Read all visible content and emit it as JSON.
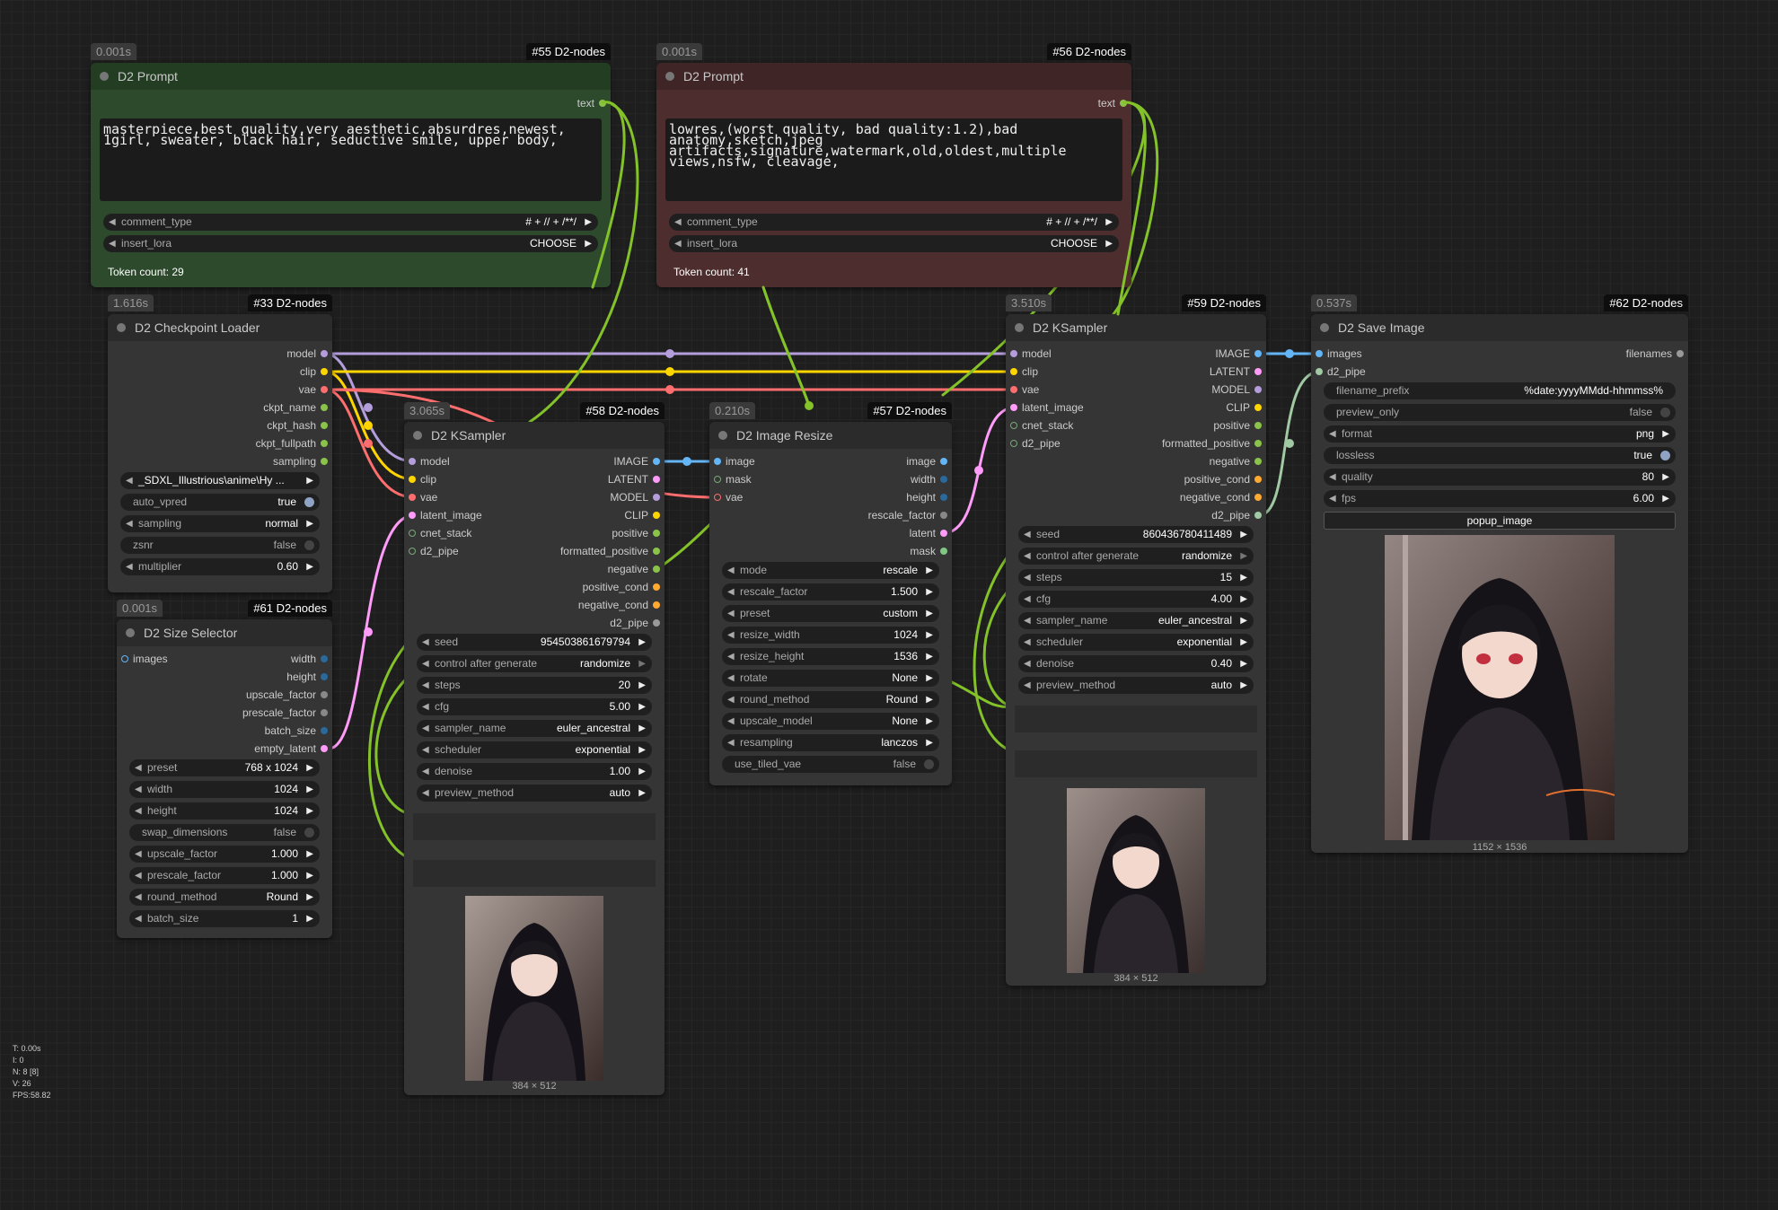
{
  "nodes": {
    "n55": {
      "time": "0.001s",
      "id": "#55 D2-nodes",
      "title": "D2 Prompt",
      "output": "text",
      "text": "masterpiece,best quality,very aesthetic,absurdres,newest,\n1girl, sweater, black hair, seductive smile, upper body,",
      "comment_type_label": "comment_type",
      "comment_type_value": "# + // + /**/",
      "insert_lora_label": "insert_lora",
      "insert_lora_value": "CHOOSE",
      "token": "Token count: 29"
    },
    "n56": {
      "time": "0.001s",
      "id": "#56 D2-nodes",
      "title": "D2 Prompt",
      "output": "text",
      "text": "lowres,(worst quality, bad quality:1.2),bad\nanatomy,sketch,jpeg\nartifacts,signature,watermark,old,oldest,multiple\nviews,nsfw, cleavage,",
      "comment_type_label": "comment_type",
      "comment_type_value": "# + // + /**/",
      "insert_lora_label": "insert_lora",
      "insert_lora_value": "CHOOSE",
      "token": "Token count: 41"
    },
    "n33": {
      "time": "1.616s",
      "id": "#33 D2-nodes",
      "title": "D2 Checkpoint Loader",
      "outputs": [
        "model",
        "clip",
        "vae",
        "ckpt_name",
        "ckpt_hash",
        "ckpt_fullpath",
        "sampling"
      ],
      "widgets": [
        [
          "_SDXL_Illustrious\\anime\\Hy ...",
          ""
        ],
        [
          "auto_vpred",
          "true"
        ],
        [
          "sampling",
          "normal"
        ],
        [
          "zsnr",
          "false"
        ],
        [
          "multiplier",
          "0.60"
        ]
      ]
    },
    "n61": {
      "time": "0.001s",
      "id": "#61 D2-nodes",
      "title": "D2 Size Selector",
      "input": "images",
      "outputs": [
        "width",
        "height",
        "upscale_factor",
        "prescale_factor",
        "batch_size",
        "empty_latent"
      ],
      "widgets": [
        [
          "preset",
          "768 x 1024"
        ],
        [
          "width",
          "1024"
        ],
        [
          "height",
          "1024"
        ],
        [
          "swap_dimensions",
          "false"
        ],
        [
          "upscale_factor",
          "1.000"
        ],
        [
          "prescale_factor",
          "1.000"
        ],
        [
          "round_method",
          "Round"
        ],
        [
          "batch_size",
          "1"
        ]
      ]
    },
    "n58": {
      "time": "3.065s",
      "id": "#58 D2-nodes",
      "title": "D2 KSampler",
      "inputs": [
        "model",
        "clip",
        "vae",
        "latent_image",
        "cnet_stack",
        "d2_pipe"
      ],
      "outputs": [
        "IMAGE",
        "LATENT",
        "MODEL",
        "CLIP",
        "positive",
        "formatted_positive",
        "negative",
        "positive_cond",
        "negative_cond",
        "d2_pipe"
      ],
      "widgets": [
        [
          "seed",
          "954503861679794"
        ],
        [
          "control after generate",
          "randomize"
        ],
        [
          "steps",
          "20"
        ],
        [
          "cfg",
          "5.00"
        ],
        [
          "sampler_name",
          "euler_ancestral"
        ],
        [
          "scheduler",
          "exponential"
        ],
        [
          "denoise",
          "1.00"
        ],
        [
          "preview_method",
          "auto"
        ]
      ],
      "caption": "384 × 512"
    },
    "n57": {
      "time": "0.210s",
      "id": "#57 D2-nodes",
      "title": "D2 Image Resize",
      "inputs": [
        "image",
        "mask",
        "vae"
      ],
      "outputs": [
        "image",
        "width",
        "height",
        "rescale_factor",
        "latent",
        "mask"
      ],
      "widgets": [
        [
          "mode",
          "rescale"
        ],
        [
          "rescale_factor",
          "1.500"
        ],
        [
          "preset",
          "custom"
        ],
        [
          "resize_width",
          "1024"
        ],
        [
          "resize_height",
          "1536"
        ],
        [
          "rotate",
          "None"
        ],
        [
          "round_method",
          "Round"
        ],
        [
          "upscale_model",
          "None"
        ],
        [
          "resampling",
          "lanczos"
        ],
        [
          "use_tiled_vae",
          "false"
        ]
      ]
    },
    "n59": {
      "time": "3.510s",
      "id": "#59 D2-nodes",
      "title": "D2 KSampler",
      "inputs": [
        "model",
        "clip",
        "vae",
        "latent_image",
        "cnet_stack",
        "d2_pipe"
      ],
      "outputs": [
        "IMAGE",
        "LATENT",
        "MODEL",
        "CLIP",
        "positive",
        "formatted_positive",
        "negative",
        "positive_cond",
        "negative_cond",
        "d2_pipe"
      ],
      "widgets": [
        [
          "seed",
          "860436780411489"
        ],
        [
          "control after generate",
          "randomize"
        ],
        [
          "steps",
          "15"
        ],
        [
          "cfg",
          "4.00"
        ],
        [
          "sampler_name",
          "euler_ancestral"
        ],
        [
          "scheduler",
          "exponential"
        ],
        [
          "denoise",
          "0.40"
        ],
        [
          "preview_method",
          "auto"
        ]
      ],
      "caption": "384 × 512"
    },
    "n62": {
      "time": "0.537s",
      "id": "#62 D2-nodes",
      "title": "D2 Save Image",
      "inputs": [
        "images",
        "d2_pipe"
      ],
      "output": "filenames",
      "widgets": [
        [
          "filename_prefix",
          "%date:yyyyMMdd-hhmmss%"
        ],
        [
          "preview_only",
          "false"
        ],
        [
          "format",
          "png"
        ],
        [
          "lossless",
          "true"
        ],
        [
          "quality",
          "80"
        ],
        [
          "fps",
          "6.00"
        ]
      ],
      "button": "popup_image",
      "caption": "1152 × 1536"
    }
  },
  "stats": [
    "T: 0.00s",
    "I: 0",
    "N: 8 [8]",
    "V: 26",
    "FPS:58.82"
  ],
  "colors": {
    "model": "#b39ddb",
    "clip": "#ffd500",
    "vae": "#ff6e6e",
    "image": "#64b5f6",
    "latent": "#ff9cf9",
    "conditioning": "#ffa931",
    "string": "#8bc34a",
    "int": "#29699c",
    "float": "#aaa",
    "pipe": "#a1c9a3",
    "text_wire": "#84c22a"
  }
}
